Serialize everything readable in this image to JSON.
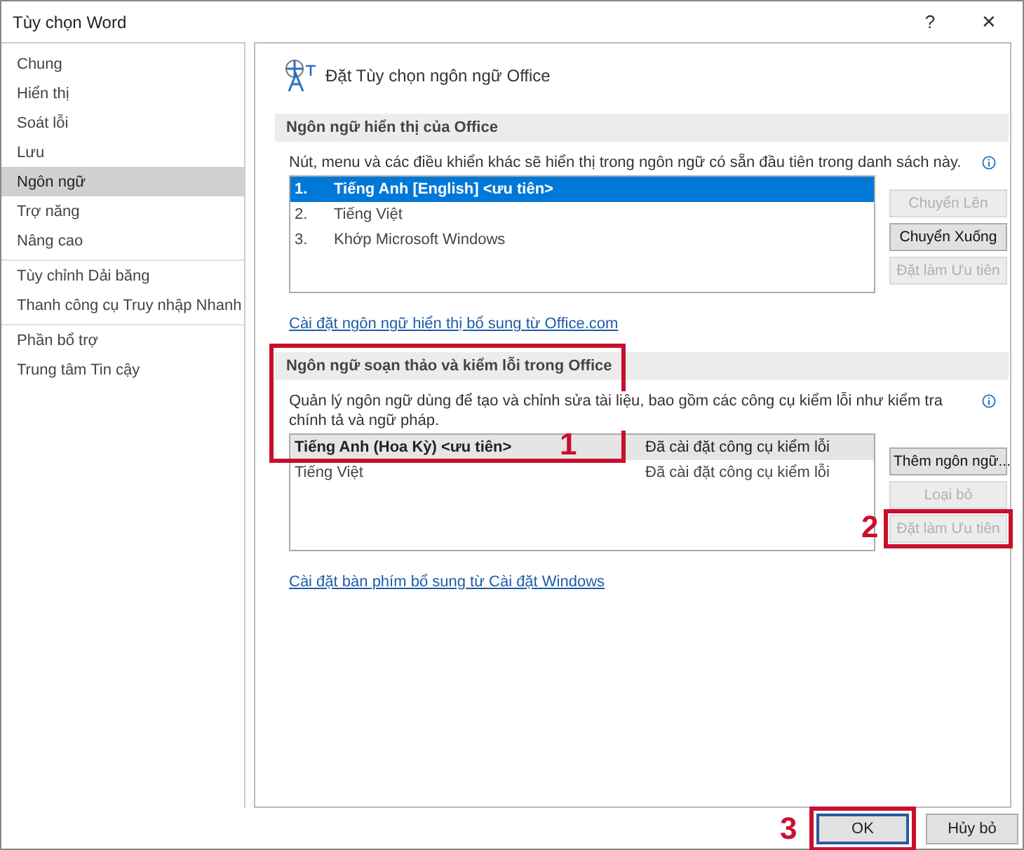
{
  "window": {
    "title": "Tùy chọn Word",
    "help": "?",
    "close": "✕"
  },
  "sidebar": {
    "groups": [
      {
        "items": [
          {
            "label": "Chung",
            "selected": false
          },
          {
            "label": "Hiển thị",
            "selected": false
          },
          {
            "label": "Soát lỗi",
            "selected": false
          },
          {
            "label": "Lưu",
            "selected": false
          },
          {
            "label": "Ngôn ngữ",
            "selected": true
          },
          {
            "label": "Trợ năng",
            "selected": false
          },
          {
            "label": "Nâng cao",
            "selected": false
          }
        ]
      },
      {
        "items": [
          {
            "label": "Tùy chỉnh Dải băng",
            "selected": false
          },
          {
            "label": "Thanh công cụ Truy nhập Nhanh",
            "selected": false
          }
        ]
      },
      {
        "items": [
          {
            "label": "Phần bổ trợ",
            "selected": false
          },
          {
            "label": "Trung tâm Tin cậy",
            "selected": false
          }
        ]
      }
    ]
  },
  "page_title": "Đặt Tùy chọn ngôn ngữ Office",
  "display_section": {
    "header": "Ngôn ngữ hiển thị của Office",
    "description": "Nút, menu và các điều khiển khác sẽ hiển thị trong ngôn ngữ có sẵn đầu tiên trong danh sách này.",
    "languages": [
      {
        "number": "1.",
        "name": "Tiếng Anh [English] <ưu tiên>",
        "selected": true
      },
      {
        "number": "2.",
        "name": "Tiếng Việt",
        "selected": false
      },
      {
        "number": "3.",
        "name": "Khớp Microsoft Windows",
        "selected": false
      }
    ],
    "buttons": [
      {
        "label": "Chuyển Lên",
        "disabled": true
      },
      {
        "label": "Chuyển Xuống",
        "disabled": false
      },
      {
        "label": "Đặt làm Ưu tiên",
        "disabled": true
      }
    ],
    "link": "Cài đặt ngôn ngữ hiển thị bổ sung từ Office.com"
  },
  "proofing_section": {
    "header": "Ngôn ngữ soạn thảo và kiểm lỗi trong Office",
    "annotation": "1",
    "description": "Quản lý ngôn ngữ dùng để tạo và chỉnh sửa tài liệu, bao gồm các công cụ kiểm lỗi như kiểm tra chính tả và ngữ pháp.",
    "languages": [
      {
        "name": "Tiếng Anh (Hoa Kỳ) <ưu tiên>",
        "status": "Đã cài đặt công cụ kiểm lỗi",
        "selected": true
      },
      {
        "name": "Tiếng Việt",
        "status": "Đã cài đặt công cụ kiểm lỗi",
        "selected": false
      }
    ],
    "buttons": [
      {
        "label": "Thêm ngôn ngữ...",
        "disabled": false
      },
      {
        "label": "Loại bỏ",
        "disabled": true
      },
      {
        "label": "Đặt làm Ưu tiên",
        "disabled": true,
        "annotation": "2"
      }
    ],
    "link": "Cài đặt bàn phím bổ sung từ Cài đặt Windows"
  },
  "footer_buttons": [
    {
      "label": "OK",
      "default": true,
      "annotation": "3"
    },
    {
      "label": "Hủy bỏ",
      "default": false
    }
  ]
}
